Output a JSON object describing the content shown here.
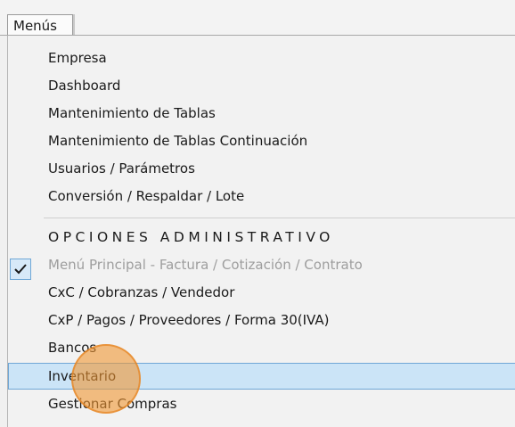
{
  "menubar": {
    "tab_label": "Menús"
  },
  "items": [
    {
      "label": "Empresa",
      "state": "normal"
    },
    {
      "label": "Dashboard",
      "state": "normal"
    },
    {
      "label": "Mantenimiento de Tablas",
      "state": "normal"
    },
    {
      "label": "Mantenimiento de Tablas Continuación",
      "state": "normal"
    },
    {
      "label": "Usuarios / Parámetros",
      "state": "normal"
    },
    {
      "label": "Conversión / Respaldar / Lote",
      "state": "normal"
    },
    {
      "label": "OPCIONES ADMINISTRATIVO",
      "state": "header"
    },
    {
      "label": "Menú Principal - Factura / Cotización / Contrato",
      "state": "disabled",
      "checked": true
    },
    {
      "label": "CxC / Cobranzas / Vendedor",
      "state": "normal"
    },
    {
      "label": "CxP / Pagos / Proveedores / Forma 30(IVA)",
      "state": "normal"
    },
    {
      "label": "Bancos",
      "state": "normal"
    },
    {
      "label": "Inventario",
      "state": "highlighted"
    },
    {
      "label": "Gestionar Compras",
      "state": "normal"
    }
  ],
  "icons": {
    "check": "check-icon"
  },
  "colors": {
    "highlight": "#cbe4f7",
    "highlight_border": "#6fa7d6",
    "click_indicator": "#f0963a"
  }
}
